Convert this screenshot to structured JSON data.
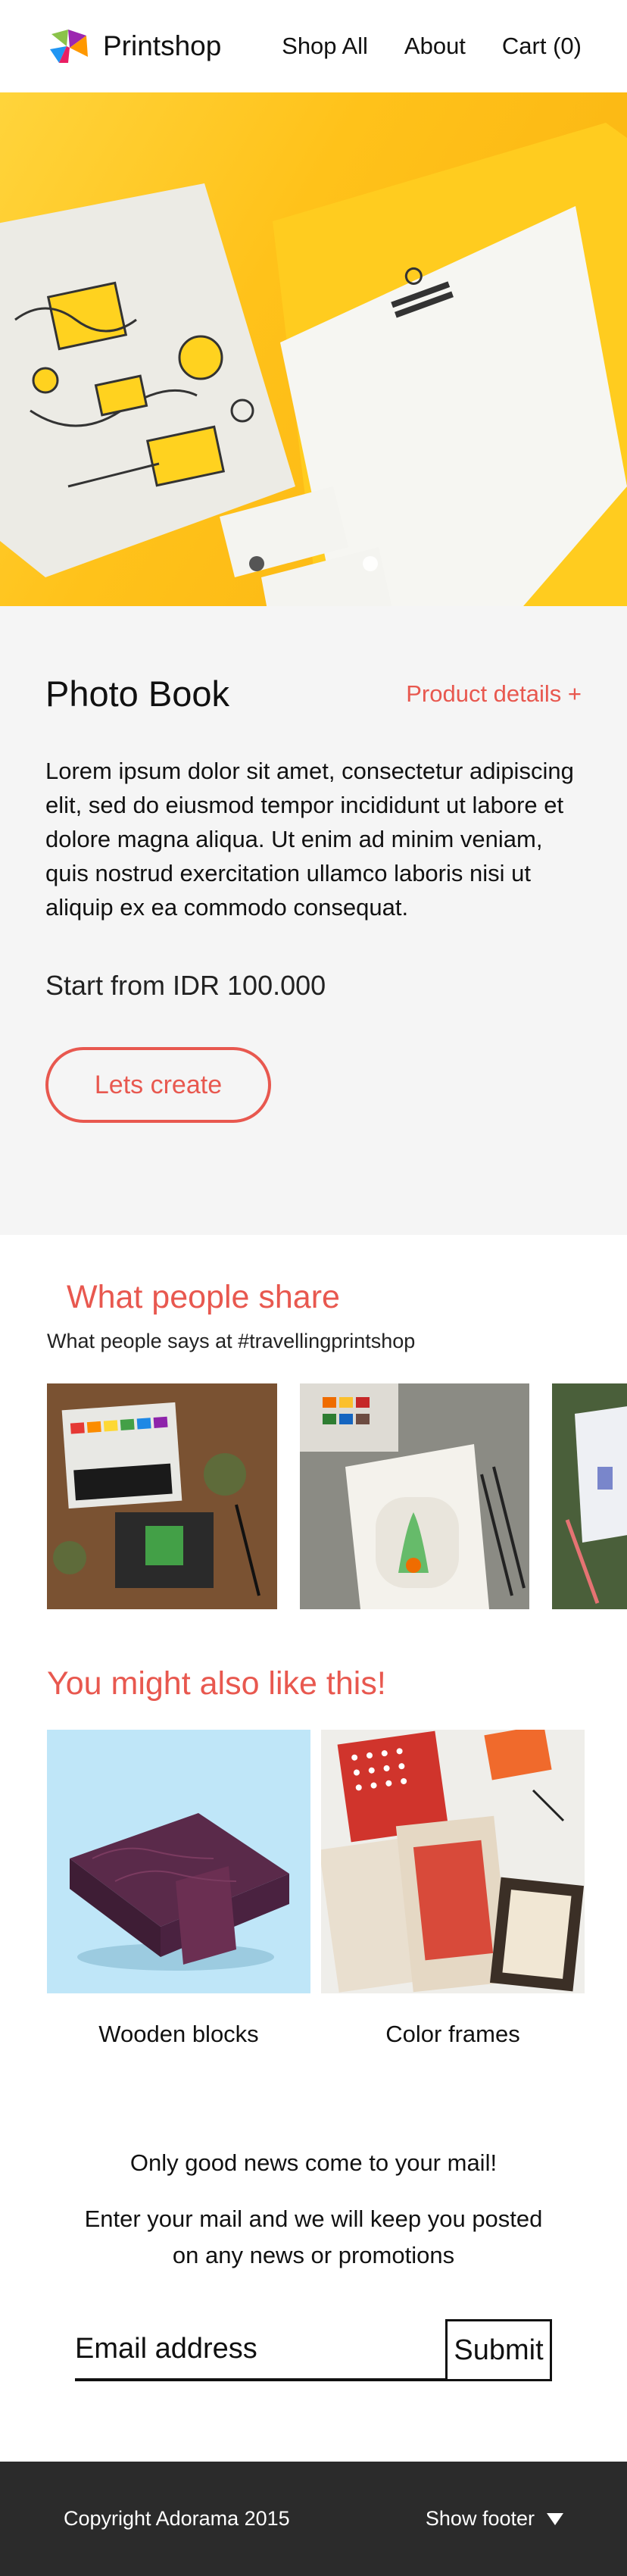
{
  "header": {
    "brand": "Printshop",
    "nav": [
      "Shop All",
      "About",
      "Cart (0)"
    ]
  },
  "hero": {
    "slides": 2,
    "active_slide": 1
  },
  "product": {
    "title": "Photo Book",
    "details_link": "Product details +",
    "description": "Lorem ipsum dolor sit amet, consectetur adipiscing elit, sed do eiusmod tempor incididunt ut labore et dolore magna aliqua. Ut enim ad minim veniam, quis nostrud exercitation ullamco laboris nisi ut aliquip ex ea commodo consequat.",
    "price": "Start from IDR 100.000",
    "cta": "Lets create"
  },
  "share": {
    "title": "What people share",
    "subtitle": "What people says at #travellingprintshop"
  },
  "recommendations": {
    "title": "You might also like this!",
    "items": [
      {
        "label": "Wooden blocks"
      },
      {
        "label": "Color frames"
      }
    ]
  },
  "newsletter": {
    "title": "Only good news come to your mail!",
    "text": "Enter your mail and we will keep you posted on any news or promotions",
    "placeholder": "Email address",
    "submit": "Submit"
  },
  "footer": {
    "copyright": "Copyright Adorama 2015",
    "toggle": "Show footer"
  },
  "colors": {
    "accent": "#e8584f",
    "hero_yellow": "#ffc21a",
    "footer_bg": "#2b2b2b"
  }
}
